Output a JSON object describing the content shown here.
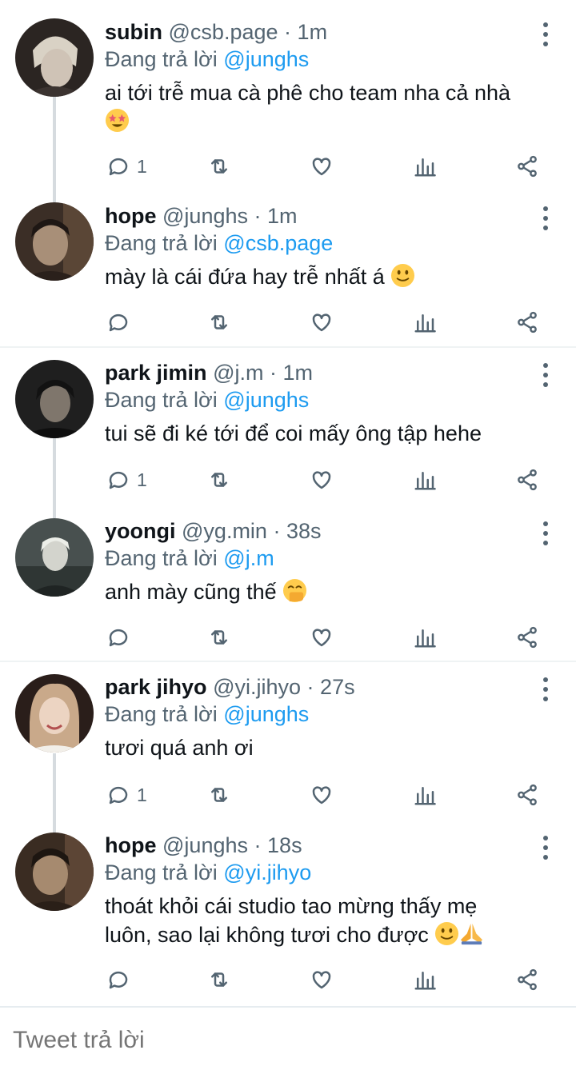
{
  "tweets": [
    {
      "name": "subin",
      "handle": "@csb.page",
      "time": "1m",
      "replying_prefix": "Đang trả lời",
      "replying_to": "@junghs",
      "text": "ai tới trễ mua cà phê cho team nha cả nhà",
      "emoji": [
        "star-struck-emoji"
      ],
      "reply_count": "1",
      "avatar_colors": [
        "#2b2522",
        "#cfc9c0"
      ]
    },
    {
      "name": "hope",
      "handle": "@junghs",
      "time": "1m",
      "replying_prefix": "Đang trả lời",
      "replying_to": "@csb.page",
      "text": "mày là cái đứa hay trễ nhất á",
      "emoji": [
        "slight-smile-emoji"
      ],
      "reply_count": "",
      "avatar_colors": [
        "#3b2e26",
        "#a88f78"
      ]
    },
    {
      "name": "park jimin",
      "handle": "@j.m",
      "time": "1m",
      "replying_prefix": "Đang trả lời",
      "replying_to": "@junghs",
      "text": "tui sẽ đi ké tới để coi mấy ông tập hehe",
      "emoji": [],
      "reply_count": "1",
      "avatar_colors": [
        "#1f1f1f",
        "#7f766c"
      ]
    },
    {
      "name": "yoongi",
      "handle": "@yg.min",
      "time": "38s",
      "replying_prefix": "Đang trả lời",
      "replying_to": "@j.m",
      "text": "anh mày cũng thế",
      "emoji": [
        "hand-over-mouth-emoji"
      ],
      "reply_count": "",
      "avatar_colors": [
        "#48504f",
        "#b9c2bc"
      ]
    },
    {
      "name": "park jihyo",
      "handle": "@yi.jihyo",
      "time": "27s",
      "replying_prefix": "Đang trả lời",
      "replying_to": "@junghs",
      "text": "tươi quá anh ơi",
      "emoji": [],
      "reply_count": "1",
      "avatar_colors": [
        "#2a1e1a",
        "#e8cfbd"
      ]
    },
    {
      "name": "hope",
      "handle": "@junghs",
      "time": "18s",
      "replying_prefix": "Đang trả lời",
      "replying_to": "@yi.jihyo",
      "text_line1": "thoát khỏi cái studio tao mừng thấy mẹ",
      "text_line2": "luôn, sao lại không tươi cho được",
      "emoji": [
        "slight-smile-emoji",
        "folded-hands-emoji"
      ],
      "reply_count": "",
      "avatar_colors": [
        "#3a2c22",
        "#a68a6f"
      ]
    }
  ],
  "separator": "·",
  "icons": {
    "reply": "reply-icon",
    "retweet": "retweet-icon",
    "like": "like-icon",
    "analytics": "analytics-icon",
    "share": "share-icon",
    "more": "more-icon"
  },
  "colors": {
    "accent": "#1d9bf0",
    "muted": "#536471",
    "text": "#0f1419"
  },
  "reply_box": {
    "placeholder": "Tweet trả lời"
  }
}
